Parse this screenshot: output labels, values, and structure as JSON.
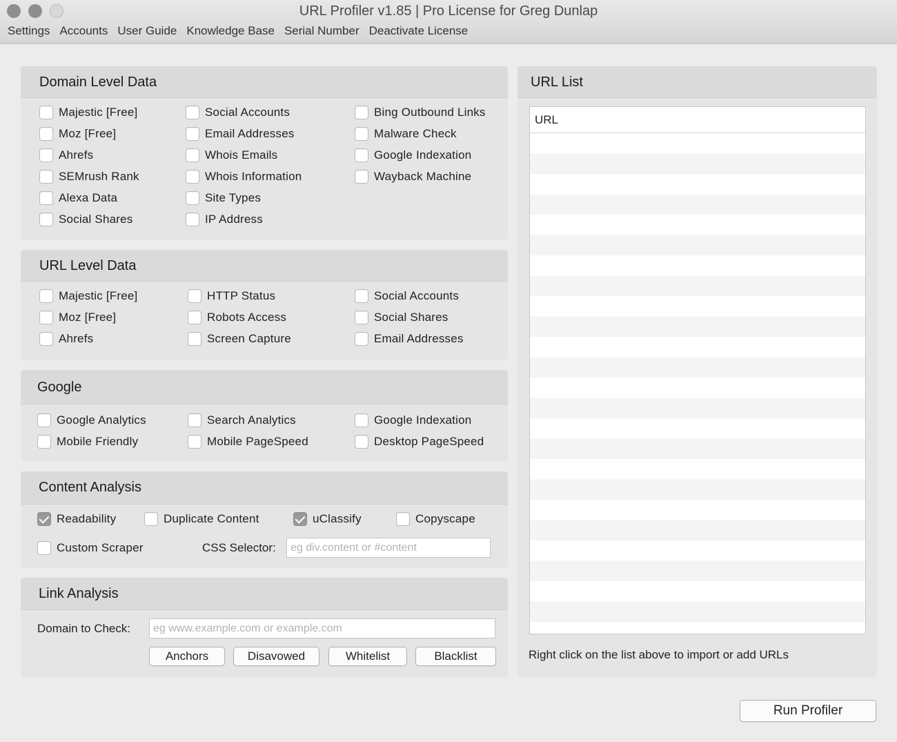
{
  "window": {
    "title": "URL Profiler v1.85 | Pro License for Greg Dunlap"
  },
  "menu": [
    "Settings",
    "Accounts",
    "User Guide",
    "Knowledge Base",
    "Serial Number",
    "Deactivate License"
  ],
  "domain_level": {
    "title": "Domain Level Data",
    "items": [
      {
        "label": "Majestic [Free]",
        "checked": false
      },
      {
        "label": "Moz [Free]",
        "checked": false
      },
      {
        "label": "Ahrefs",
        "checked": false
      },
      {
        "label": "SEMrush Rank",
        "checked": false
      },
      {
        "label": "Alexa Data",
        "checked": false
      },
      {
        "label": "Social Shares",
        "checked": false
      },
      {
        "label": "Social Accounts",
        "checked": false
      },
      {
        "label": "Email Addresses",
        "checked": false
      },
      {
        "label": "Whois Emails",
        "checked": false
      },
      {
        "label": "Whois Information",
        "checked": false
      },
      {
        "label": "Site Types",
        "checked": false
      },
      {
        "label": "IP Address",
        "checked": false
      },
      {
        "label": "Bing Outbound Links",
        "checked": false
      },
      {
        "label": "Malware Check",
        "checked": false
      },
      {
        "label": "Google Indexation",
        "checked": false
      },
      {
        "label": "Wayback Machine",
        "checked": false
      }
    ]
  },
  "url_level": {
    "title": "URL Level Data",
    "items": [
      {
        "label": "Majestic [Free]",
        "checked": false
      },
      {
        "label": "Moz [Free]",
        "checked": false
      },
      {
        "label": "Ahrefs",
        "checked": false
      },
      {
        "label": "HTTP Status",
        "checked": false
      },
      {
        "label": "Robots Access",
        "checked": false
      },
      {
        "label": "Screen Capture",
        "checked": false
      },
      {
        "label": "Social Accounts",
        "checked": false
      },
      {
        "label": "Social Shares",
        "checked": false
      },
      {
        "label": "Email Addresses",
        "checked": false
      }
    ]
  },
  "google": {
    "title": "Google",
    "items": [
      {
        "label": "Google Analytics",
        "checked": false
      },
      {
        "label": "Mobile Friendly",
        "checked": false
      },
      {
        "label": "Search Analytics",
        "checked": false
      },
      {
        "label": "Mobile PageSpeed",
        "checked": false
      },
      {
        "label": "Google Indexation",
        "checked": false
      },
      {
        "label": "Desktop PageSpeed",
        "checked": false
      }
    ]
  },
  "content": {
    "title": "Content Analysis",
    "items": [
      {
        "label": "Readability",
        "checked": true
      },
      {
        "label": "Duplicate Content",
        "checked": false
      },
      {
        "label": "uClassify",
        "checked": true
      },
      {
        "label": "Copyscape",
        "checked": false
      },
      {
        "label": "Custom Scraper",
        "checked": false
      }
    ],
    "css_selector_label": "CSS Selector:",
    "css_selector_placeholder": "eg div.content or #content",
    "css_selector_value": ""
  },
  "link": {
    "title": "Link Analysis",
    "domain_label": "Domain to Check:",
    "domain_placeholder": "eg www.example.com or example.com",
    "domain_value": "",
    "buttons": [
      "Anchors",
      "Disavowed",
      "Whitelist",
      "Blacklist"
    ]
  },
  "url_list": {
    "title": "URL List",
    "column": "URL",
    "hint": "Right click on the list above to import or add URLs"
  },
  "run_button": "Run Profiler"
}
